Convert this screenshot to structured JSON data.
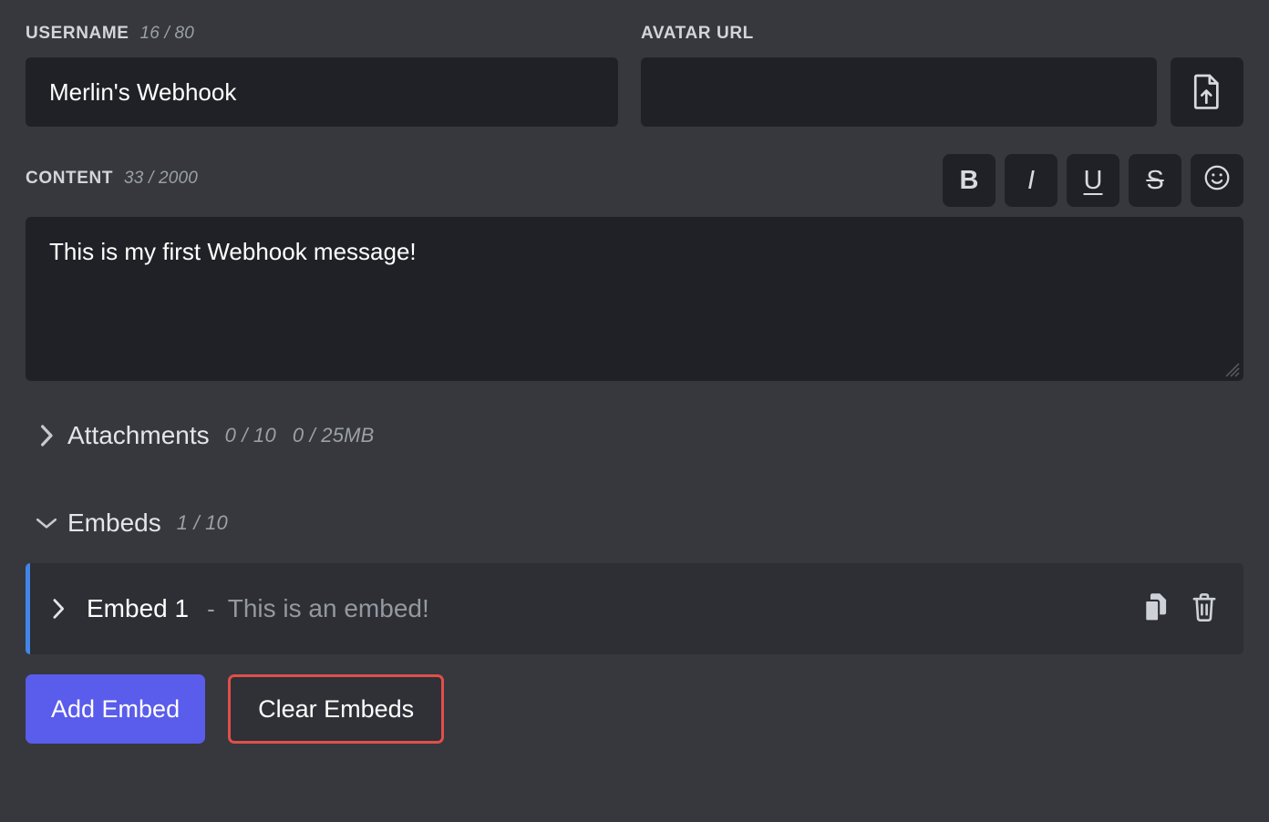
{
  "username": {
    "label": "USERNAME",
    "counter": "16 / 80",
    "value": "Merlin's Webhook",
    "placeholder": ""
  },
  "avatar": {
    "label": "AVATAR URL",
    "value": "",
    "placeholder": "",
    "upload_icon": "file-upload-icon"
  },
  "content": {
    "label": "CONTENT",
    "counter": "33 / 2000",
    "value": "This is my first Webhook message!",
    "placeholder": "",
    "toolbar": [
      {
        "label": "B",
        "name": "bold-button",
        "style": "bold"
      },
      {
        "label": "I",
        "name": "italic-button",
        "style": "italic"
      },
      {
        "label": "U",
        "name": "underline-button",
        "style": "underline"
      },
      {
        "label": "S",
        "name": "strikethrough-button",
        "style": "strike"
      },
      {
        "label": "",
        "name": "emoji-button",
        "style": "emoji"
      }
    ]
  },
  "attachments": {
    "title": "Attachments",
    "expanded": false,
    "chevron": "chevron-right-icon",
    "count": "0 / 10",
    "size": "0 / 25MB"
  },
  "embeds": {
    "title": "Embeds",
    "expanded": true,
    "chevron": "chevron-down-icon",
    "count": "1 / 10",
    "items": [
      {
        "name": "Embed 1",
        "separator": "-",
        "description": "This is an embed!",
        "chevron": "chevron-right-icon",
        "duplicate_icon": "duplicate-icon",
        "delete_icon": "trash-icon",
        "accent_color": "#4285e8"
      }
    ],
    "add_label": "Add Embed",
    "clear_label": "Clear Embeds"
  },
  "colors": {
    "background": "#36383d",
    "input_background": "#202126",
    "embed_row_background": "#2d2f34",
    "primary": "#5a5ceb",
    "danger": "#e04f4a",
    "accent_blue": "#4285e8",
    "label_text": "#d2d5d9",
    "muted_text": "#9ba0a7"
  }
}
